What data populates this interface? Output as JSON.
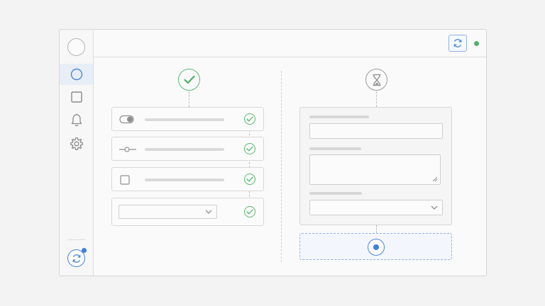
{
  "colors": {
    "accent": "#3f7fe0",
    "success": "#5cb872",
    "pending": "#9a9a9a",
    "online": "#55b06a"
  },
  "sidebar": {
    "avatar_icon": "avatar-circle",
    "items": [
      {
        "icon": "circle-icon",
        "active": true
      },
      {
        "icon": "square-icon",
        "active": false
      },
      {
        "icon": "bell-icon",
        "active": false
      },
      {
        "icon": "gear-icon",
        "active": false
      }
    ],
    "sync_icon": "sync-icon",
    "has_notification": true
  },
  "topbar": {
    "sync_icon": "sync-icon",
    "status": "online"
  },
  "left_column": {
    "status": "complete",
    "status_icon": "checkmark-icon",
    "rows": [
      {
        "control": "toggle",
        "control_icon": "toggle-icon",
        "done": true
      },
      {
        "control": "slider",
        "control_icon": "slider-icon",
        "done": true
      },
      {
        "control": "checkbox",
        "control_icon": "checkbox-icon",
        "done": true
      },
      {
        "control": "select",
        "control_icon": "chevron-down-icon",
        "done": true
      }
    ]
  },
  "right_column": {
    "status": "pending",
    "status_icon": "hourglass-icon",
    "fields": [
      {
        "type": "text-input"
      },
      {
        "type": "textarea"
      },
      {
        "type": "select",
        "icon": "chevron-down-icon"
      }
    ],
    "submit_icon": "radio-dot-icon"
  }
}
